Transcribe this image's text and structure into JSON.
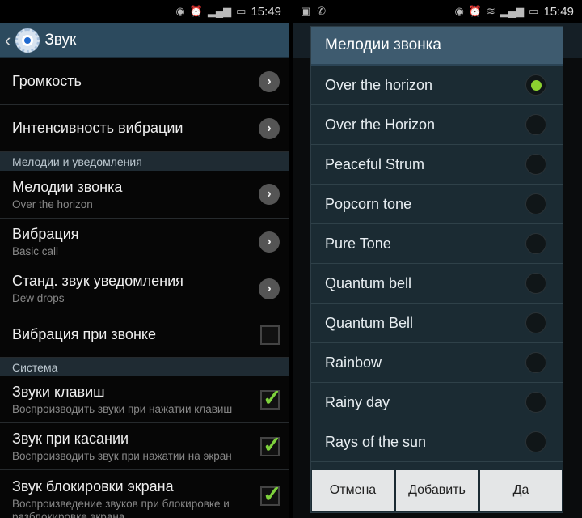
{
  "status": {
    "time": "15:49"
  },
  "left": {
    "title": "Звук",
    "rows1": [
      {
        "title": "Громкость"
      },
      {
        "title": "Интенсивность вибрации"
      }
    ],
    "section1": "Мелодии и уведомления",
    "rows2": [
      {
        "title": "Мелодии звонка",
        "sub": "Over the horizon"
      },
      {
        "title": "Вибрация",
        "sub": "Basic call"
      },
      {
        "title": "Станд. звук уведомления",
        "sub": "Dew drops"
      }
    ],
    "vibrate_on_ring": {
      "title": "Вибрация при звонке",
      "checked": false
    },
    "section2": "Система",
    "rows3": [
      {
        "title": "Звуки клавиш",
        "sub": "Воспроизводить звуки при нажатии клавиш",
        "checked": true
      },
      {
        "title": "Звук при касании",
        "sub": "Воспроизводить звук при нажатии на экран",
        "checked": true
      },
      {
        "title": "Звук блокировки экрана",
        "sub": "Воспроизведение звуков при блокировке и",
        "sub2": "разблокировке экрана",
        "checked": true
      }
    ]
  },
  "dialog": {
    "title": "Мелодии звонка",
    "options": [
      "Over the horizon",
      "Over the Horizon",
      "Peaceful Strum",
      "Popcorn tone",
      "Pure Tone",
      "Quantum bell",
      "Quantum Bell",
      "Rainbow",
      "Rainy day",
      "Rays of the sun"
    ],
    "selected": "Over the horizon",
    "buttons": {
      "cancel": "Отмена",
      "add": "Добавить",
      "ok": "Да"
    }
  },
  "colors": {
    "accent": "#8cd230",
    "actionbar": "#2c4a5e"
  }
}
